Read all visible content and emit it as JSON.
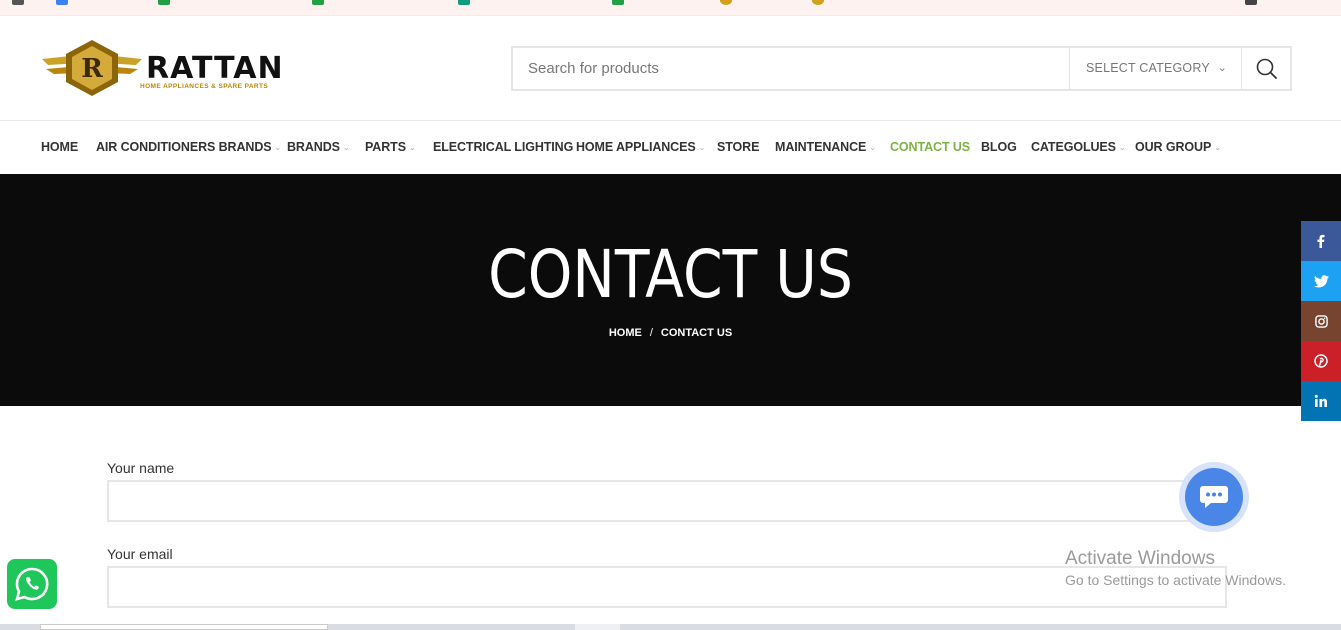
{
  "brand": {
    "letter": "R",
    "name": "RATTAN",
    "tagline": "HOME APPLIANCES & SPARE PARTS"
  },
  "search": {
    "placeholder": "Search for products",
    "category_label": "SELECT CATEGORY"
  },
  "nav": {
    "items": [
      {
        "label": "HOME",
        "dropdown": false
      },
      {
        "label": "AIR CONDITIONERS BRANDS",
        "dropdown": true
      },
      {
        "label": "BRANDS",
        "dropdown": true
      },
      {
        "label": "PARTS",
        "dropdown": true
      },
      {
        "label": "ELECTRICAL LIGHTING",
        "dropdown": false
      },
      {
        "label": "HOME APPLIANCES",
        "dropdown": true
      },
      {
        "label": "STORE",
        "dropdown": false
      },
      {
        "label": "MAINTENANCE",
        "dropdown": true
      },
      {
        "label": "CONTACT US",
        "dropdown": false,
        "active": true
      },
      {
        "label": "BLOG",
        "dropdown": false
      },
      {
        "label": "CATEGOLUES",
        "dropdown": true
      },
      {
        "label": "OUR GROUP",
        "dropdown": true
      }
    ],
    "active_color": "#7cb342"
  },
  "banner": {
    "title": "CONTACT US",
    "breadcrumb_home": "HOME",
    "breadcrumb_sep": "/",
    "breadcrumb_current": "CONTACT US",
    "background": "#0b0b0b"
  },
  "social": [
    {
      "name": "facebook-icon",
      "glyph": "f",
      "color": "#3b5998"
    },
    {
      "name": "twitter-icon",
      "glyph": "t",
      "color": "#1da1f2"
    },
    {
      "name": "instagram-icon",
      "glyph": "ig",
      "color": "#774430"
    },
    {
      "name": "pinterest-icon",
      "glyph": "p",
      "color": "#cb2027"
    },
    {
      "name": "linkedin-icon",
      "glyph": "in",
      "color": "#0274b3"
    }
  ],
  "form": {
    "name_label": "Your name",
    "email_label": "Your email"
  },
  "watermark": {
    "line1": "Activate Windows",
    "line2": "Go to Settings to activate Windows."
  }
}
